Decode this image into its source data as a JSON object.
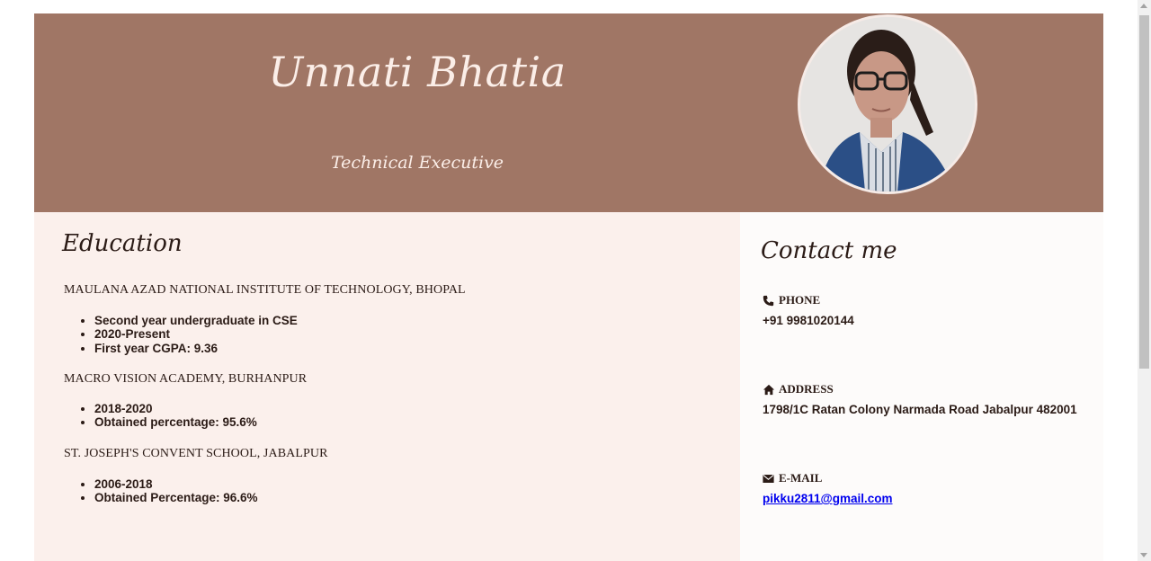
{
  "header": {
    "name": "Unnati Bhatia",
    "role": "Technical Executive"
  },
  "education": {
    "title": "Education",
    "schools": [
      {
        "name": "MAULANA AZAD NATIONAL INSTITUTE OF TECHNOLOGY, BHOPAL",
        "details": [
          "Second year undergraduate in CSE",
          "2020-Present",
          "First year CGPA: 9.36"
        ]
      },
      {
        "name": "MACRO VISION ACADEMY, BURHANPUR",
        "details": [
          "2018-2020",
          "Obtained percentage: 95.6%"
        ]
      },
      {
        "name": "ST. JOSEPH'S CONVENT SCHOOL, JABALPUR",
        "details": [
          "2006-2018",
          "Obtained Percentage: 96.6%"
        ]
      }
    ]
  },
  "contact": {
    "title": "Contact me",
    "phone": {
      "label": "PHONE",
      "value": "+91 9981020144",
      "icon": "phone-icon"
    },
    "address": {
      "label": "ADDRESS",
      "value": "1798/1C Ratan Colony Narmada Road Jabalpur 482001",
      "icon": "home-icon"
    },
    "email": {
      "label": "E-MAIL",
      "value": "pikku2811@gmail.com",
      "icon": "envelope-icon"
    }
  },
  "colors": {
    "header_bg": "#a07665",
    "education_bg": "#fbf0ec",
    "contact_bg": "#fdfbfa",
    "text": "#2b1b16",
    "link": "#0000ee"
  }
}
